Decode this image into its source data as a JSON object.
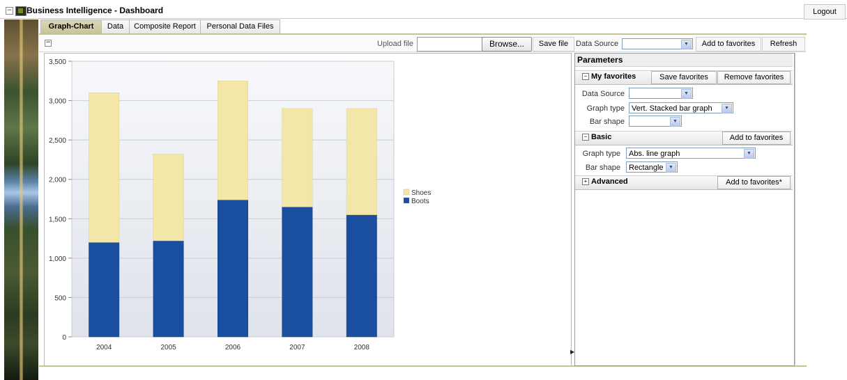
{
  "app": {
    "title": "Business Intelligence - Dashboard",
    "logout_label": "Logout"
  },
  "tabs": [
    {
      "label": "Graph-Chart",
      "active": true
    },
    {
      "label": "Data",
      "active": false
    },
    {
      "label": "Composite Report",
      "active": false
    },
    {
      "label": "Personal Data Files",
      "active": false
    }
  ],
  "toolbar": {
    "upload_label": "Upload file",
    "upload_value": "",
    "browse_label": "Browse...",
    "save_file_label": "Save file",
    "data_source_label": "Data Source",
    "data_source_value": "",
    "add_to_favorites_label": "Add to favorites",
    "refresh_label": "Refresh"
  },
  "parameters": {
    "title": "Parameters",
    "my_favorites": {
      "label": "My favorites",
      "save_label": "Save favorites",
      "remove_label": "Remove favorites",
      "data_source_label": "Data Source",
      "data_source_value": "",
      "graph_type_label": "Graph type",
      "graph_type_value": "Vert. Stacked bar graph",
      "bar_shape_label": "Bar shape",
      "bar_shape_value": ""
    },
    "basic": {
      "label": "Basic",
      "add_label": "Add to favorites",
      "graph_type_label": "Graph type",
      "graph_type_value": "Abs. line graph",
      "bar_shape_label": "Bar shape",
      "bar_shape_value": "Rectangle"
    },
    "advanced": {
      "label": "Advanced",
      "add_label": "Add to favorites*"
    }
  },
  "colors": {
    "shoes": "#f2e6a8",
    "boots": "#1a4fa0",
    "tab_active": "#d0cda4"
  },
  "chart_data": {
    "type": "bar",
    "stacked": true,
    "categories": [
      "2004",
      "2005",
      "2006",
      "2007",
      "2008"
    ],
    "series": [
      {
        "name": "Boots",
        "values": [
          1200,
          1220,
          1740,
          1650,
          1550
        ]
      },
      {
        "name": "Shoes",
        "values": [
          1900,
          1100,
          1510,
          1250,
          1350
        ]
      }
    ],
    "ylim": [
      0,
      3500
    ],
    "yticks": [
      "0",
      "500",
      "1,000",
      "1,500",
      "2,000",
      "2,500",
      "3,000",
      "3,500"
    ],
    "title": "",
    "xlabel": "",
    "ylabel": "",
    "legend": [
      "Shoes",
      "Boots"
    ],
    "legend_position": "right",
    "grid": true
  }
}
